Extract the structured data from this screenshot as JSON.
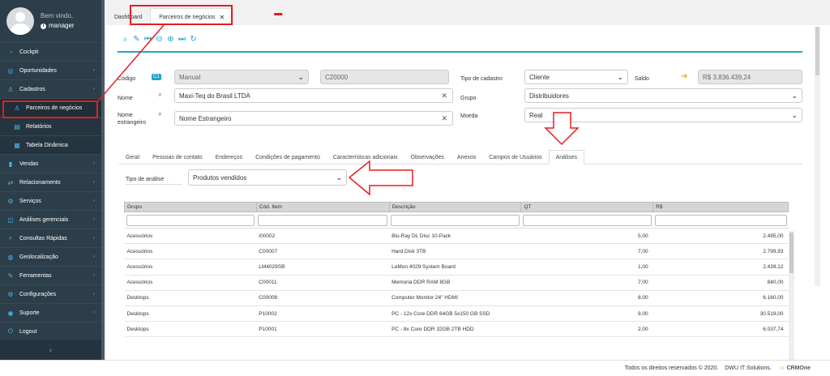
{
  "sidebar": {
    "welcome": "Bem vindo,",
    "username": "manager",
    "items": [
      {
        "label": "Cockpit",
        "icon": "gauge-icon",
        "glyph": "◔",
        "chevron": false
      },
      {
        "label": "Oportunidades",
        "icon": "target-icon",
        "glyph": "◎",
        "chevron": true
      },
      {
        "label": "Cadastros",
        "icon": "users-icon",
        "glyph": "♙",
        "chevron": true
      },
      {
        "label": "Parceiros de negócios",
        "icon": "partners-icon",
        "glyph": "♙",
        "chevron": false,
        "sub": true,
        "active": true
      },
      {
        "label": "Relatórios",
        "icon": "report-icon",
        "glyph": "▤",
        "chevron": false,
        "sub": true
      },
      {
        "label": "Tabela Dinâmica",
        "icon": "pivot-table-icon",
        "glyph": "▦",
        "chevron": false,
        "sub": true
      },
      {
        "label": "Vendas",
        "icon": "bar-chart-icon",
        "glyph": "▮",
        "chevron": true
      },
      {
        "label": "Relacionamento",
        "icon": "handshake-icon",
        "glyph": "⇄",
        "chevron": true
      },
      {
        "label": "Serviços",
        "icon": "gears-icon",
        "glyph": "⚙",
        "chevron": true
      },
      {
        "label": "Análises gerenciais",
        "icon": "analysis-icon",
        "glyph": "◫",
        "chevron": true
      },
      {
        "label": "Consultas Rápidas",
        "icon": "search-icon",
        "glyph": "⌕",
        "chevron": true
      },
      {
        "label": "Geolocalização",
        "icon": "globe-icon",
        "glyph": "◍",
        "chevron": true
      },
      {
        "label": "Ferramentas",
        "icon": "wrench-icon",
        "glyph": "✎",
        "chevron": true
      },
      {
        "label": "Configurações",
        "icon": "cog-icon",
        "glyph": "⚙",
        "chevron": true
      },
      {
        "label": "Suporte",
        "icon": "lifebuoy-icon",
        "glyph": "◉",
        "chevron": true
      },
      {
        "label": "Logout",
        "icon": "logout-icon",
        "glyph": "⏻",
        "chevron": false
      }
    ],
    "collapse_glyph": "‹"
  },
  "tabs": [
    {
      "label": "Dashboard",
      "active": false
    },
    {
      "label": "Parceiros de negócios",
      "active": true,
      "close": "✕"
    }
  ],
  "toolbar": {
    "icons": [
      {
        "name": "search-icon",
        "glyph": "⌕"
      },
      {
        "name": "edit-icon",
        "glyph": "✎"
      },
      {
        "name": "first-record-icon",
        "glyph": "⏮"
      },
      {
        "name": "previous-record-icon",
        "glyph": "⊖"
      },
      {
        "name": "next-record-icon",
        "glyph": "⊕"
      },
      {
        "name": "last-record-icon",
        "glyph": "⏭"
      },
      {
        "name": "refresh-icon",
        "glyph": "↻"
      }
    ]
  },
  "form": {
    "codigo_label": "Código",
    "codigo_badge": "C1",
    "codigo_mode": "Manual",
    "codigo_value": "C20000",
    "tipo_cadastro_label": "Tipo de cadastro",
    "tipo_cadastro_value": "Cliente",
    "saldo_label": "Saldo",
    "saldo_value": "R$ 3.836.439,24",
    "nome_label": "Nome",
    "nome_value": "Maxi-Teq do Brasil LTDA",
    "grupo_label": "Grupo",
    "grupo_value": "Distribuidores",
    "nome_estrangeiro_label": "Nome estrangeiro",
    "nome_estrangeiro_value": "Nome Estrangeiro",
    "moeda_label": "Moeda",
    "moeda_value": "Real"
  },
  "subtabs": [
    {
      "label": "Geral"
    },
    {
      "label": "Pessoas de contato"
    },
    {
      "label": "Endereços"
    },
    {
      "label": "Condições de pagamento"
    },
    {
      "label": "Características adicionais"
    },
    {
      "label": "Observações"
    },
    {
      "label": "Anexos"
    },
    {
      "label": "Campos de Usuários"
    },
    {
      "label": "Análises",
      "active": true
    }
  ],
  "analysis": {
    "tipo_label": "Tipo de análise",
    "tipo_value": "Produtos vendidos"
  },
  "table": {
    "columns": [
      "Grupo",
      "Cód. Item",
      "Descrição",
      "QT",
      "R$"
    ],
    "rows": [
      [
        "Acessórios",
        "I00002",
        "Blu-Ray DL Disc 10-Pack",
        "5,00",
        "2.495,00"
      ],
      [
        "Acessórios",
        "C00007",
        "Hard Disk 3TB",
        "7,00",
        "2.799,93"
      ],
      [
        "Acessórios",
        "LM4029SB",
        "LeMon 4029 System Board",
        "1,00",
        "2.439,12"
      ],
      [
        "Acessórios",
        "C00011",
        "Memoria DDR RAM 8GB",
        "7,00",
        "840,00"
      ],
      [
        "Desktops",
        "C00008",
        "Computer Monitor 24\" HDMI",
        "8,00",
        "6.160,00"
      ],
      [
        "Desktops",
        "P10002",
        "PC - 12x Core DDR 64GB 5x150 GB SSD",
        "9,00",
        "30.519,00"
      ],
      [
        "Desktops",
        "P10001",
        "PC - 8x Core DDR 32GB 2TB HDD",
        "2,00",
        "6.037,74"
      ]
    ]
  },
  "footer": {
    "rights": "Todos os direitos reservados © 2020.",
    "company": "DWU IT Solutions.",
    "logo": "CRMOne"
  },
  "colors": {
    "sidebar_bg": "#2b3e4a",
    "accent": "#21a3c9",
    "annotation": "#e51c23",
    "saldo_arrow": "#f2a61c"
  }
}
